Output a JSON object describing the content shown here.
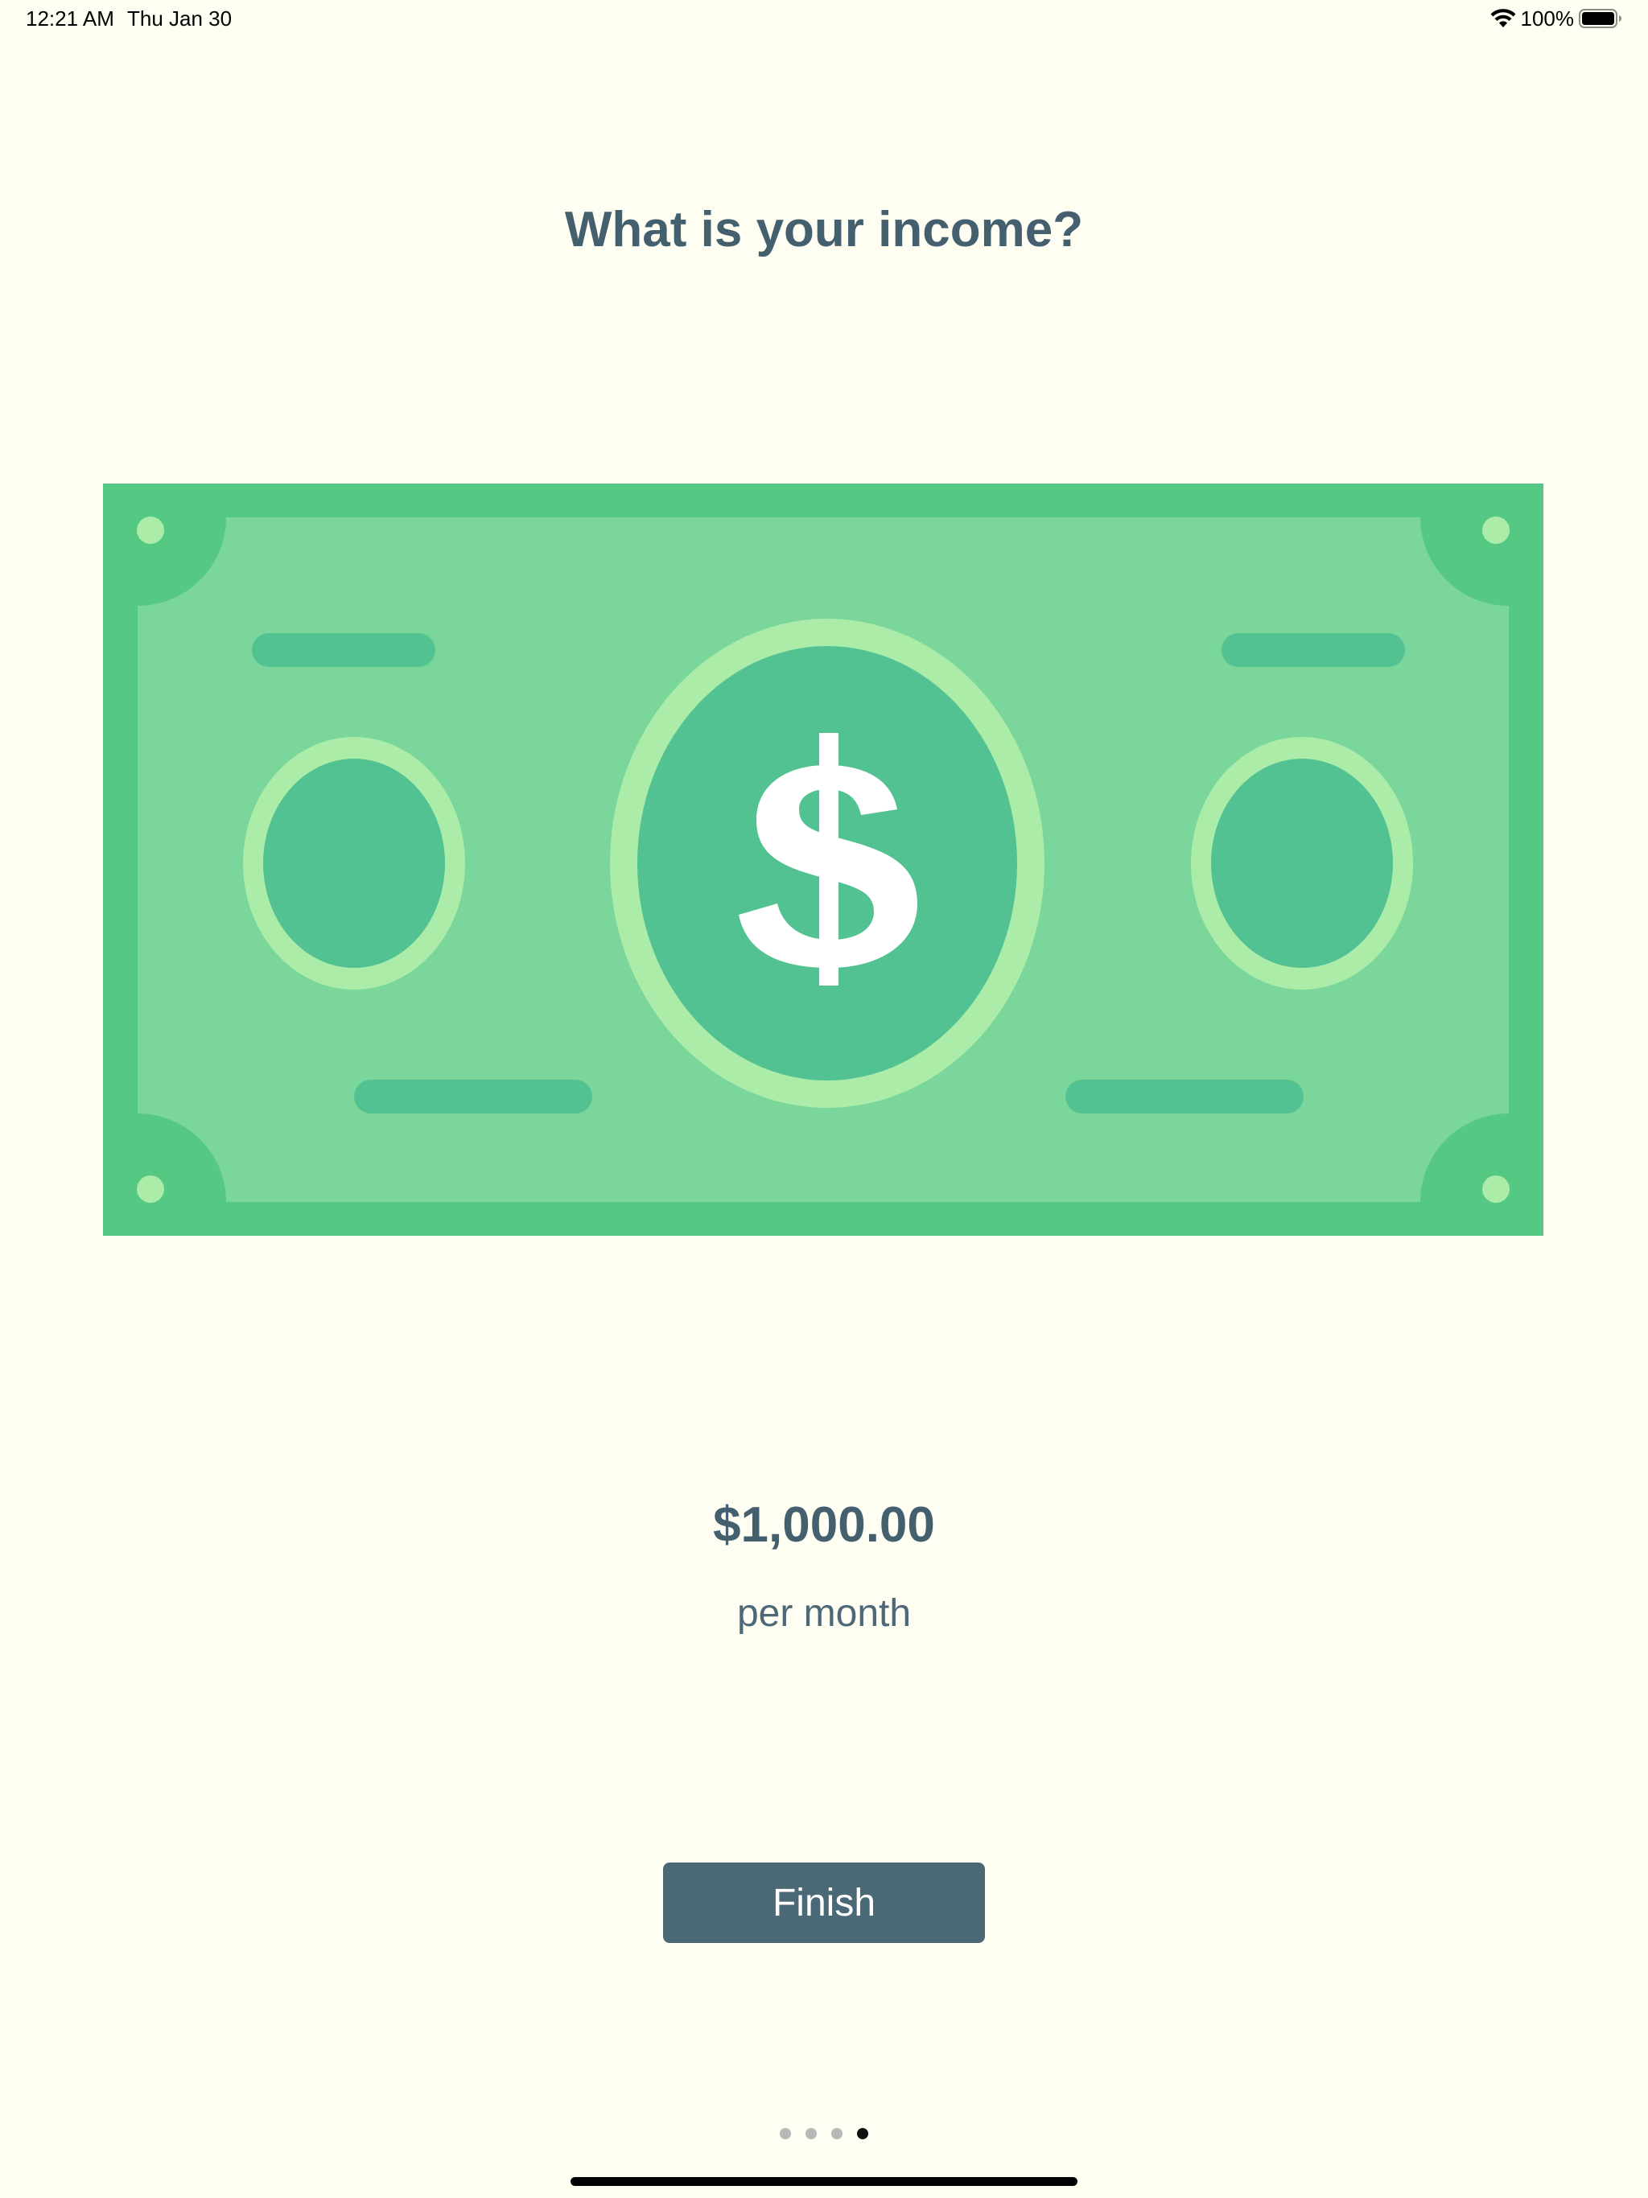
{
  "status_bar": {
    "time": "12:21 AM",
    "date": "Thu Jan 30",
    "battery_percent": "100%",
    "icons": [
      "wifi-icon",
      "battery-icon"
    ]
  },
  "onboarding": {
    "title": "What is your income?",
    "illustration": "dollar-bill",
    "income_amount": "$1,000.00",
    "income_period": "per month",
    "finish_label": "Finish",
    "pages_total": 4,
    "current_page_index": 3
  },
  "colors": {
    "background": "#FFFEF2",
    "title_text": "#44606F",
    "button": "#4A6876",
    "bill_outer": "#55C984",
    "bill_inner": "#7AD69A",
    "bill_accent": "#52C292",
    "bill_ring": "#ABEDA8"
  }
}
